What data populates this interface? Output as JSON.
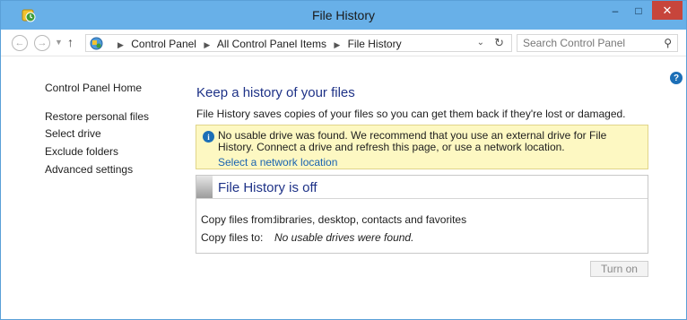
{
  "window": {
    "title": "File History",
    "minimize_glyph": "‒",
    "maximize_glyph": "□",
    "close_glyph": "✕"
  },
  "addressbar": {
    "breadcrumbs": [
      "Control Panel",
      "All Control Panel Items",
      "File History"
    ],
    "search_placeholder": "Search Control Panel"
  },
  "leftnav": {
    "home": "Control Panel Home",
    "items": [
      "Restore personal files",
      "Select drive",
      "Exclude folders",
      "Advanced settings"
    ]
  },
  "main": {
    "title": "Keep a history of your files",
    "description": "File History saves copies of your files so you can get them back if they're lost or damaged."
  },
  "info": {
    "text": "No usable drive was found. We recommend that you use an external drive for File History. Connect a drive and refresh this page, or use a network location.",
    "link": "Select a network location"
  },
  "status": {
    "title": "File History is off",
    "copy_from_label": "Copy files from:",
    "copy_from_value": "libraries, desktop, contacts and favorites",
    "copy_to_label": "Copy files to:",
    "copy_to_value": "No usable drives were found."
  },
  "actions": {
    "turn_on": "Turn on"
  },
  "colors": {
    "titlebar": "#68b0e8",
    "heading": "#1e3287",
    "link": "#1a63b0",
    "info_bg": "#fdf8c2",
    "close_button": "#c7453b"
  },
  "icons": [
    "file-history-icon",
    "back-icon",
    "forward-icon",
    "up-arrow-icon",
    "control-panel-icon",
    "refresh-icon",
    "search-icon",
    "help-icon",
    "info-icon"
  ]
}
